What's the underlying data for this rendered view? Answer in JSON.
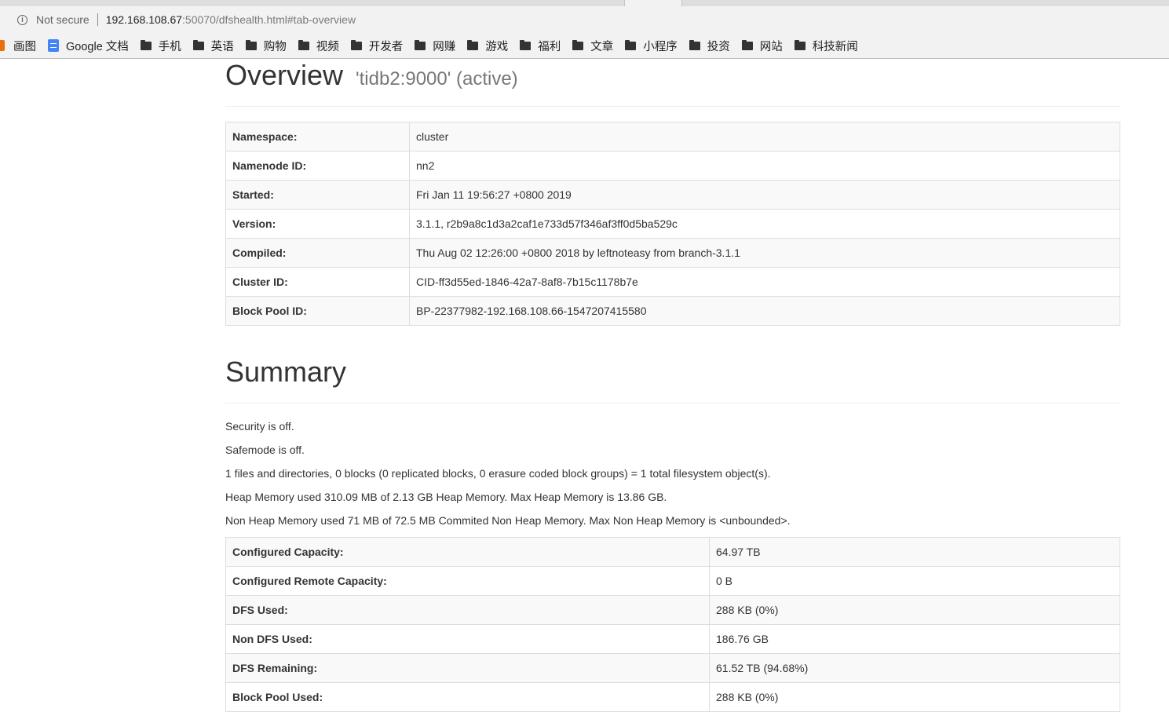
{
  "browser": {
    "not_secure": "Not secure",
    "url_host": "192.168.108.67",
    "url_rest": ":50070/dfshealth.html#tab-overview"
  },
  "bookmarks": [
    {
      "label": "画图",
      "icon": "orange-app-icon"
    },
    {
      "label": "Google 文档",
      "icon": "google-docs-icon"
    },
    {
      "label": "手机",
      "icon": "folder-icon"
    },
    {
      "label": "英语",
      "icon": "folder-icon"
    },
    {
      "label": "购物",
      "icon": "folder-icon"
    },
    {
      "label": "视频",
      "icon": "folder-icon"
    },
    {
      "label": "开发者",
      "icon": "folder-icon"
    },
    {
      "label": "网赚",
      "icon": "folder-icon"
    },
    {
      "label": "游戏",
      "icon": "folder-icon"
    },
    {
      "label": "福利",
      "icon": "folder-icon"
    },
    {
      "label": "文章",
      "icon": "folder-icon"
    },
    {
      "label": "小程序",
      "icon": "folder-icon"
    },
    {
      "label": "投资",
      "icon": "folder-icon"
    },
    {
      "label": "网站",
      "icon": "folder-icon"
    },
    {
      "label": "科技新闻",
      "icon": "folder-icon"
    }
  ],
  "overview": {
    "title": "Overview",
    "subtitle": "'tidb2:9000' (active)",
    "rows": [
      {
        "key": "Namespace:",
        "value": "cluster"
      },
      {
        "key": "Namenode ID:",
        "value": "nn2"
      },
      {
        "key": "Started:",
        "value": "Fri Jan 11 19:56:27 +0800 2019"
      },
      {
        "key": "Version:",
        "value": "3.1.1, r2b9a8c1d3a2caf1e733d57f346af3ff0d5ba529c"
      },
      {
        "key": "Compiled:",
        "value": "Thu Aug 02 12:26:00 +0800 2018 by leftnoteasy from branch-3.1.1"
      },
      {
        "key": "Cluster ID:",
        "value": "CID-ff3d55ed-1846-42a7-8af8-7b15c1178b7e"
      },
      {
        "key": "Block Pool ID:",
        "value": "BP-22377982-192.168.108.66-1547207415580"
      }
    ]
  },
  "summary": {
    "title": "Summary",
    "lines": [
      "Security is off.",
      "Safemode is off.",
      "1 files and directories, 0 blocks (0 replicated blocks, 0 erasure coded block groups) = 1 total filesystem object(s).",
      "Heap Memory used 310.09 MB of 2.13 GB Heap Memory. Max Heap Memory is 13.86 GB.",
      "Non Heap Memory used 71 MB of 72.5 MB Commited Non Heap Memory. Max Non Heap Memory is <unbounded>."
    ],
    "rows": [
      {
        "key": "Configured Capacity:",
        "value": "64.97 TB"
      },
      {
        "key": "Configured Remote Capacity:",
        "value": "0 B"
      },
      {
        "key": "DFS Used:",
        "value": "288 KB (0%)"
      },
      {
        "key": "Non DFS Used:",
        "value": "186.76 GB"
      },
      {
        "key": "DFS Remaining:",
        "value": "61.52 TB (94.68%)"
      },
      {
        "key": "Block Pool Used:",
        "value": "288 KB (0%)"
      }
    ]
  }
}
